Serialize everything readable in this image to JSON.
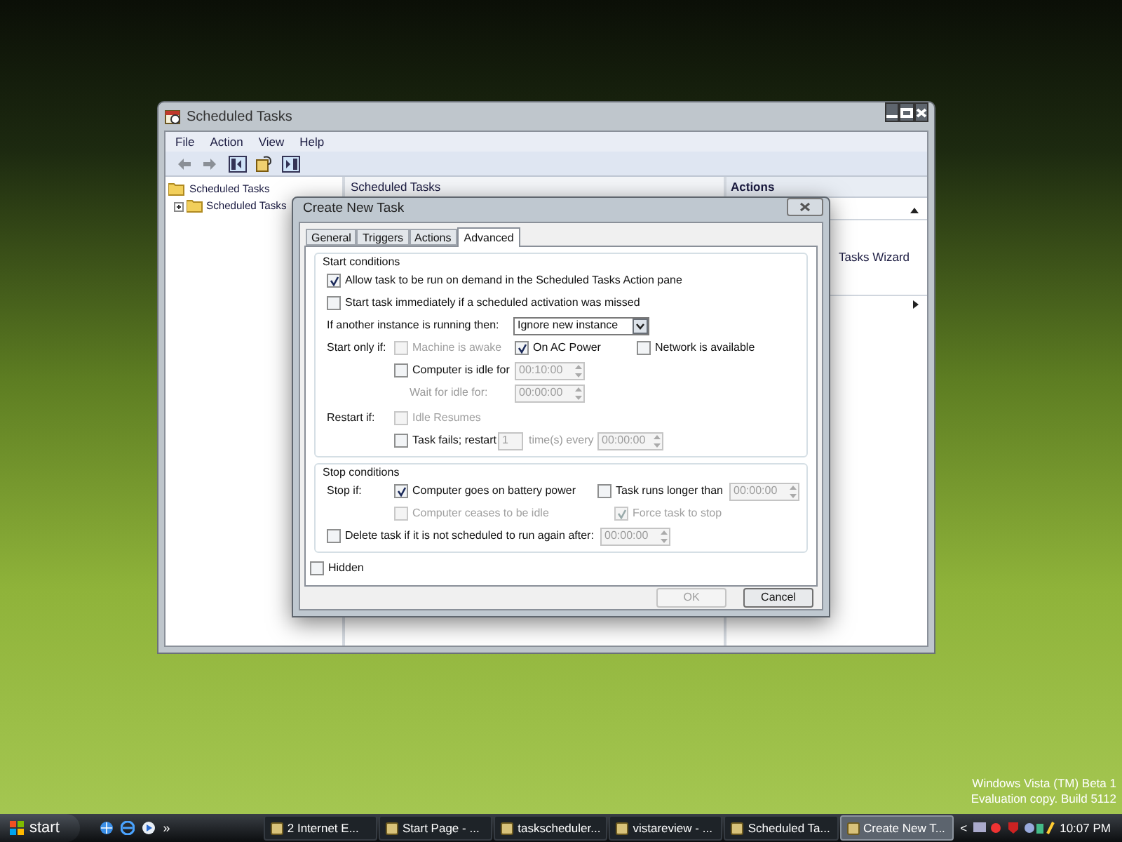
{
  "desktop": {
    "watermark": [
      "Windows Vista (TM) Beta 1",
      "Evaluation copy. Build 5112"
    ]
  },
  "main_window": {
    "title": "Scheduled Tasks",
    "menu": [
      "File",
      "Action",
      "View",
      "Help"
    ],
    "tree": [
      {
        "label": "Scheduled Tasks",
        "children": [
          {
            "label": "Scheduled Tasks",
            "expanded": false
          }
        ]
      }
    ],
    "center_header": "Scheduled Tasks",
    "actions": {
      "header": "Actions",
      "items": [
        "Tasks Wizard"
      ]
    }
  },
  "dialog": {
    "title": "Create New Task",
    "tabs": [
      {
        "label": "General",
        "selected": false
      },
      {
        "label": "Triggers",
        "selected": false
      },
      {
        "label": "Actions",
        "selected": false
      },
      {
        "label": "Advanced",
        "selected": true
      }
    ],
    "start_conditions": {
      "title": "Start conditions",
      "allow_on_demand": {
        "label": "Allow task to be run on demand in the Scheduled Tasks Action pane",
        "checked": true
      },
      "start_if_missed": {
        "label": "Start task immediately if a scheduled activation was missed",
        "checked": false
      },
      "instance": {
        "label": "If another instance is running then:",
        "value": "Ignore new instance"
      },
      "start_only_label": "Start only if:",
      "machine_awake": {
        "label": "Machine is awake",
        "checked": false,
        "disabled": true
      },
      "on_ac_power": {
        "label": "On AC Power",
        "checked": true
      },
      "network_available": {
        "label": "Network is available",
        "checked": false
      },
      "computer_idle": {
        "label": "Computer is idle for",
        "checked": false,
        "duration": "00:10:00"
      },
      "wait_for_idle": {
        "label": "Wait for idle for:",
        "duration": "00:00:00"
      },
      "restart_label": "Restart if:",
      "idle_resumes": {
        "label": "Idle Resumes",
        "checked": false,
        "disabled": true
      },
      "task_fails": {
        "label": "Task fails; restart",
        "checked": false,
        "count": "1",
        "every": "time(s) every",
        "duration": "00:00:00"
      }
    },
    "stop_conditions": {
      "title": "Stop conditions",
      "stop_label": "Stop if:",
      "battery": {
        "label": "Computer goes on battery power",
        "checked": true
      },
      "runs_longer": {
        "label": "Task runs longer than",
        "checked": false,
        "duration": "00:00:00"
      },
      "ceases_idle": {
        "label": "Computer ceases to be idle",
        "checked": false,
        "disabled": true
      },
      "force_stop": {
        "label": "Force task to stop",
        "checked": true,
        "disabled": true
      },
      "delete_task": {
        "label": "Delete task if it is not scheduled to run again after:",
        "checked": false,
        "duration": "00:00:00"
      }
    },
    "hidden": {
      "label": "Hidden",
      "checked": false
    },
    "buttons": [
      {
        "label": "OK",
        "disabled": true
      },
      {
        "label": "Cancel",
        "disabled": false
      }
    ]
  },
  "taskbar": {
    "start": "start",
    "chevron": "»",
    "tasks": [
      {
        "label": "2 Internet E...",
        "selected": false
      },
      {
        "label": "Start Page - ...",
        "selected": false
      },
      {
        "label": "taskscheduler...",
        "selected": false
      },
      {
        "label": "vistareview - ...",
        "selected": false
      },
      {
        "label": "Scheduled Ta...",
        "selected": false
      },
      {
        "label": "Create New T...",
        "selected": true
      }
    ],
    "tray_arrow": "<",
    "clock": "10:07 PM"
  }
}
